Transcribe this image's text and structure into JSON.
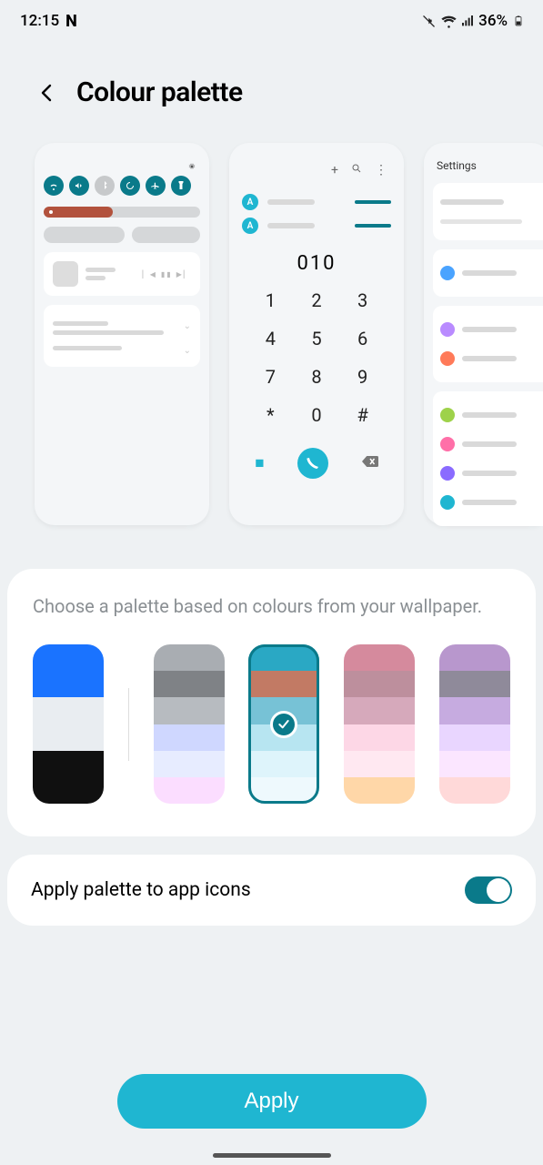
{
  "status": {
    "time": "12:15",
    "app_icon": "N",
    "battery": "36%"
  },
  "header": {
    "title": "Colour palette"
  },
  "previews": {
    "phone": {
      "number": "010",
      "keys": [
        "1",
        "2",
        "3",
        "4",
        "5",
        "6",
        "7",
        "8",
        "9",
        "*",
        "0",
        "#"
      ],
      "contact_initial": "A"
    },
    "settings": {
      "title": "Settings"
    }
  },
  "palette_section": {
    "description": "Choose a palette based on colours from your wallpaper.",
    "palettes": [
      {
        "colors": [
          "#1a73ff",
          "#1a73ff",
          "#e9edf1",
          "#e9edf1",
          "#101010",
          "#101010"
        ],
        "selected": false
      },
      {
        "colors": [
          "#a9adb2",
          "#7f8286",
          "#b7bbc0",
          "#cfd7ff",
          "#e7ecff",
          "#fbddff"
        ],
        "selected": false
      },
      {
        "colors": [
          "#2aa8c4",
          "#c27a64",
          "#77c2d6",
          "#b7e5f1",
          "#def4fb",
          "#eef9fd"
        ],
        "selected": true
      },
      {
        "colors": [
          "#d58a9d",
          "#bd8f9d",
          "#d6a9bb",
          "#fdd7e6",
          "#ffe8f1",
          "#ffd7a8"
        ],
        "selected": false
      },
      {
        "colors": [
          "#b897cd",
          "#8f8a9a",
          "#c6abe0",
          "#e9d6ff",
          "#fbe6ff",
          "#ffd9d9"
        ],
        "selected": false
      }
    ]
  },
  "toggle": {
    "label": "Apply palette to app icons",
    "on": true
  },
  "apply": {
    "label": "Apply"
  }
}
